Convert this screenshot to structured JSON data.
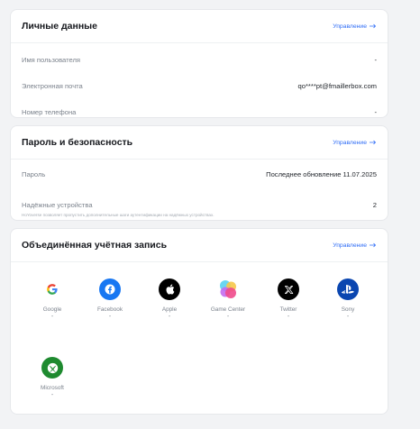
{
  "personal": {
    "title": "Личные данные",
    "manage": "Управление",
    "rows": [
      {
        "label": "Имя пользователя",
        "value": "-"
      },
      {
        "label": "Электронная почта",
        "value": "qo****pt@fmaillerbox.com"
      },
      {
        "label": "Номер телефона",
        "value": "-"
      }
    ]
  },
  "security": {
    "title": "Пароль и безопасность",
    "manage": "Управление",
    "password_label": "Пароль",
    "password_value": "Последнее обновление 11.07.2025",
    "devices_label": "Надёжные устройства",
    "devices_value": "2",
    "devices_hint": "HoYoverse позволяет пропустить дополнительные шаги аутентификации на надёжных устройствах."
  },
  "linked": {
    "title": "Объединённая учётная запись",
    "manage": "Управление",
    "providers": [
      {
        "name": "Google",
        "status": "-",
        "icon": "google-icon"
      },
      {
        "name": "Facebook",
        "status": "-",
        "icon": "facebook-icon"
      },
      {
        "name": "Apple",
        "status": "-",
        "icon": "apple-icon"
      },
      {
        "name": "Game Center",
        "status": "-",
        "icon": "game-center-icon"
      },
      {
        "name": "Twitter",
        "status": "-",
        "icon": "x-icon"
      },
      {
        "name": "Sony",
        "status": "-",
        "icon": "playstation-icon"
      },
      {
        "name": "Microsoft",
        "status": "-",
        "icon": "xbox-icon"
      }
    ]
  },
  "colors": {
    "accent": "#2f6df6",
    "facebook": "#1877f2",
    "playstation": "#0a46b0",
    "xbox": "#1e8a2f"
  }
}
